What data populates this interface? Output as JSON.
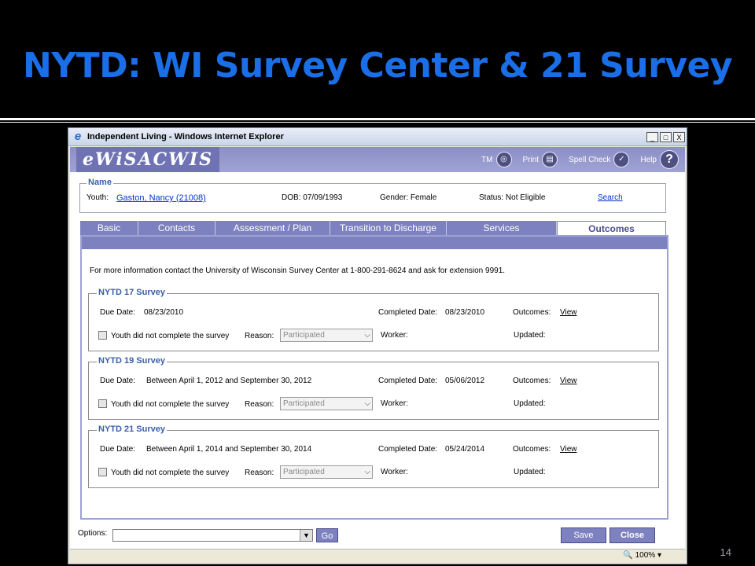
{
  "slide": {
    "title": "NYTD: WI Survey Center & 21 Survey",
    "page_number": "14"
  },
  "window": {
    "title": "Independent Living - Windows Internet Explorer",
    "min": "_",
    "max": "□",
    "close": "X"
  },
  "app": {
    "logo": "eWiSACWIS",
    "toolbar": {
      "tm": "TM",
      "print": "Print",
      "spell": "Spell Check",
      "help": "Help",
      "help_glyph": "?"
    }
  },
  "name_box": {
    "legend": "Name",
    "youth_label": "Youth:",
    "youth_value": "Gaston, Nancy (21008)",
    "dob": "DOB: 07/09/1993",
    "gender": "Gender: Female",
    "status": "Status:  Not Eligible",
    "search": "Search"
  },
  "tabs": [
    {
      "label": "Basic"
    },
    {
      "label": "Contacts"
    },
    {
      "label": "Assessment / Plan"
    },
    {
      "label": "Transition to Discharge"
    },
    {
      "label": "Services"
    },
    {
      "label": "Outcomes"
    }
  ],
  "info_text": "For more information contact the University of Wisconsin Survey Center at 1-800-291-8624 and ask for extension 9991.",
  "surveys": [
    {
      "legend": "NYTD 17 Survey",
      "due_label": "Due Date:",
      "due_value": "08/23/2010",
      "completed_label": "Completed Date:",
      "completed_value": "08/23/2010",
      "outcomes_label": "Outcomes:",
      "outcomes_link": "View",
      "not_complete_label": "Youth did not complete the survey",
      "reason_label": "Reason:",
      "reason_value": "Participated",
      "worker_label": "Worker:",
      "updated_label": "Updated:"
    },
    {
      "legend": "NYTD 19 Survey",
      "due_label": "Due Date:",
      "due_value": "Between April 1, 2012 and September 30, 2012",
      "completed_label": "Completed Date:",
      "completed_value": "05/06/2012",
      "outcomes_label": "Outcomes:",
      "outcomes_link": "View",
      "not_complete_label": "Youth did not complete the survey",
      "reason_label": "Reason:",
      "reason_value": "Participated",
      "worker_label": "Worker:",
      "updated_label": "Updated:"
    },
    {
      "legend": "NYTD 21 Survey",
      "due_label": "Due Date:",
      "due_value": "Between April 1, 2014 and September 30, 2014",
      "completed_label": "Completed Date:",
      "completed_value": "05/24/2014",
      "outcomes_label": "Outcomes:",
      "outcomes_link": "View",
      "not_complete_label": "Youth did not complete the survey",
      "reason_label": "Reason:",
      "reason_value": "Participated",
      "worker_label": "Worker:",
      "updated_label": "Updated:"
    }
  ],
  "footer": {
    "options_label": "Options:",
    "go": "Go",
    "save": "Save",
    "close": "Close"
  },
  "statusbar": {
    "zoom": "100%"
  },
  "colors": {
    "title_blue": "#1a6fe8",
    "tab_purple": "#7d81bf",
    "link_blue": "#0033cc"
  }
}
